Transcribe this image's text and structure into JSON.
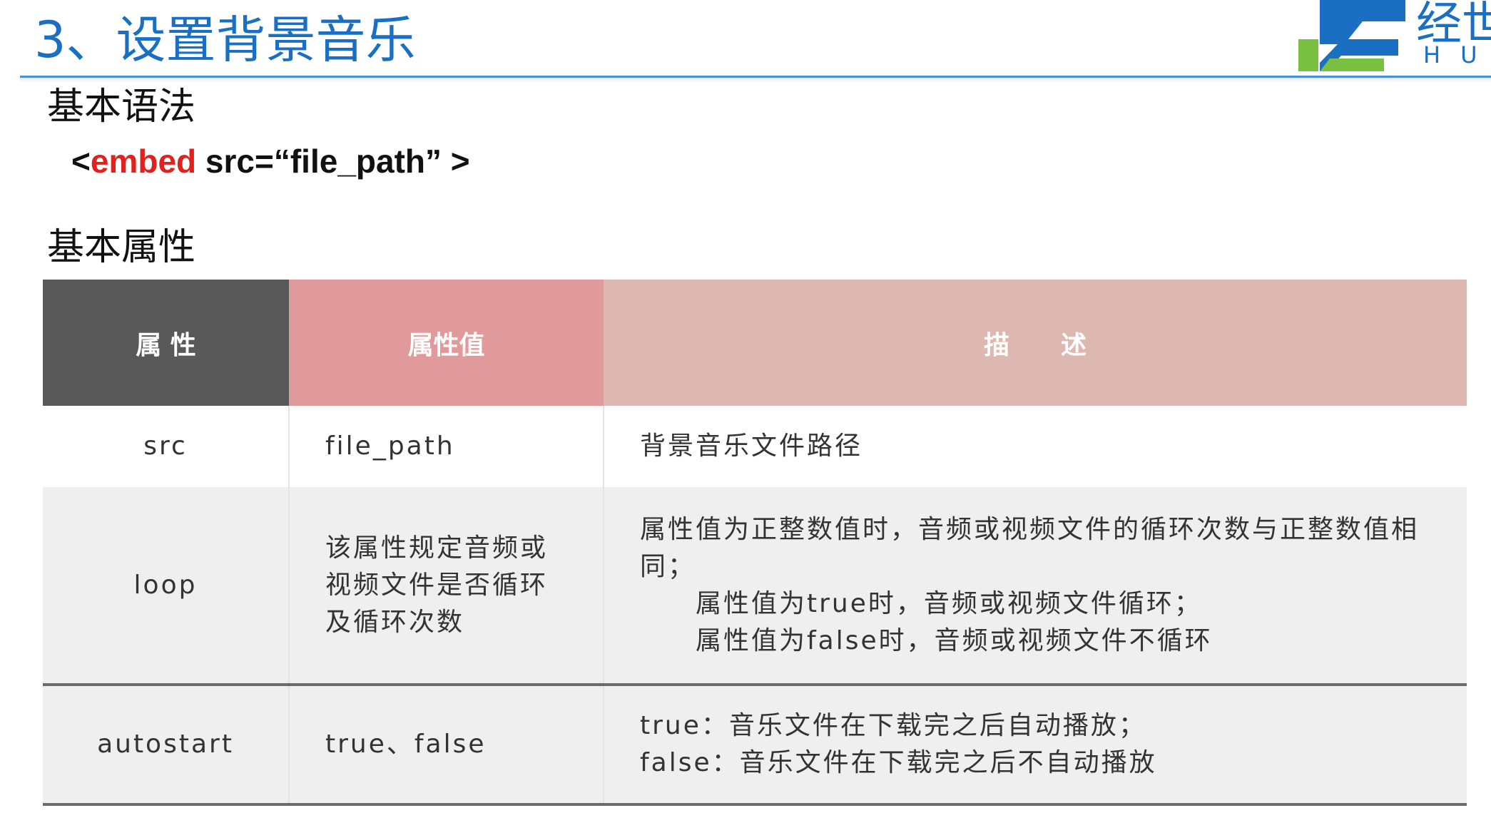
{
  "slide": {
    "title": "3、设置背景音乐"
  },
  "logo": {
    "text_top": "经世",
    "text_bottom": "HU"
  },
  "syntax": {
    "heading": "基本语法",
    "open": "<",
    "keyword": "embed",
    "rest": " src=“file_path” >"
  },
  "attributes": {
    "heading": "基本属性",
    "columns": [
      "属 性",
      "属性值",
      "描　　述"
    ],
    "rows": [
      {
        "attr": "src",
        "value_lines": [
          "file_path"
        ],
        "desc_lines": [
          "背景音乐文件路径"
        ]
      },
      {
        "attr": "loop",
        "value_lines": [
          "该属性规定音频或",
          "视频文件是否循环",
          "及循环次数"
        ],
        "desc_lines": [
          "属性值为正整数值时，音频或视频文件的循环次数与正整数值相",
          "同；",
          "属性值为true时，音频或视频文件循环；",
          "属性值为false时，音频或视频文件不循环"
        ]
      },
      {
        "attr": "autostart",
        "value_lines": [
          "true、false"
        ],
        "desc_lines": [
          "true：音乐文件在下载完之后自动播放；",
          "false：音乐文件在下载完之后不自动播放"
        ]
      }
    ]
  },
  "colors": {
    "title": "#1a6fc2",
    "keyword": "#e0211c",
    "header_attr": "#595959",
    "header_value": "#e09a9b",
    "header_desc": "#ddb8b0",
    "logo_blue": "#1a6fc2",
    "logo_green": "#7ac143"
  }
}
